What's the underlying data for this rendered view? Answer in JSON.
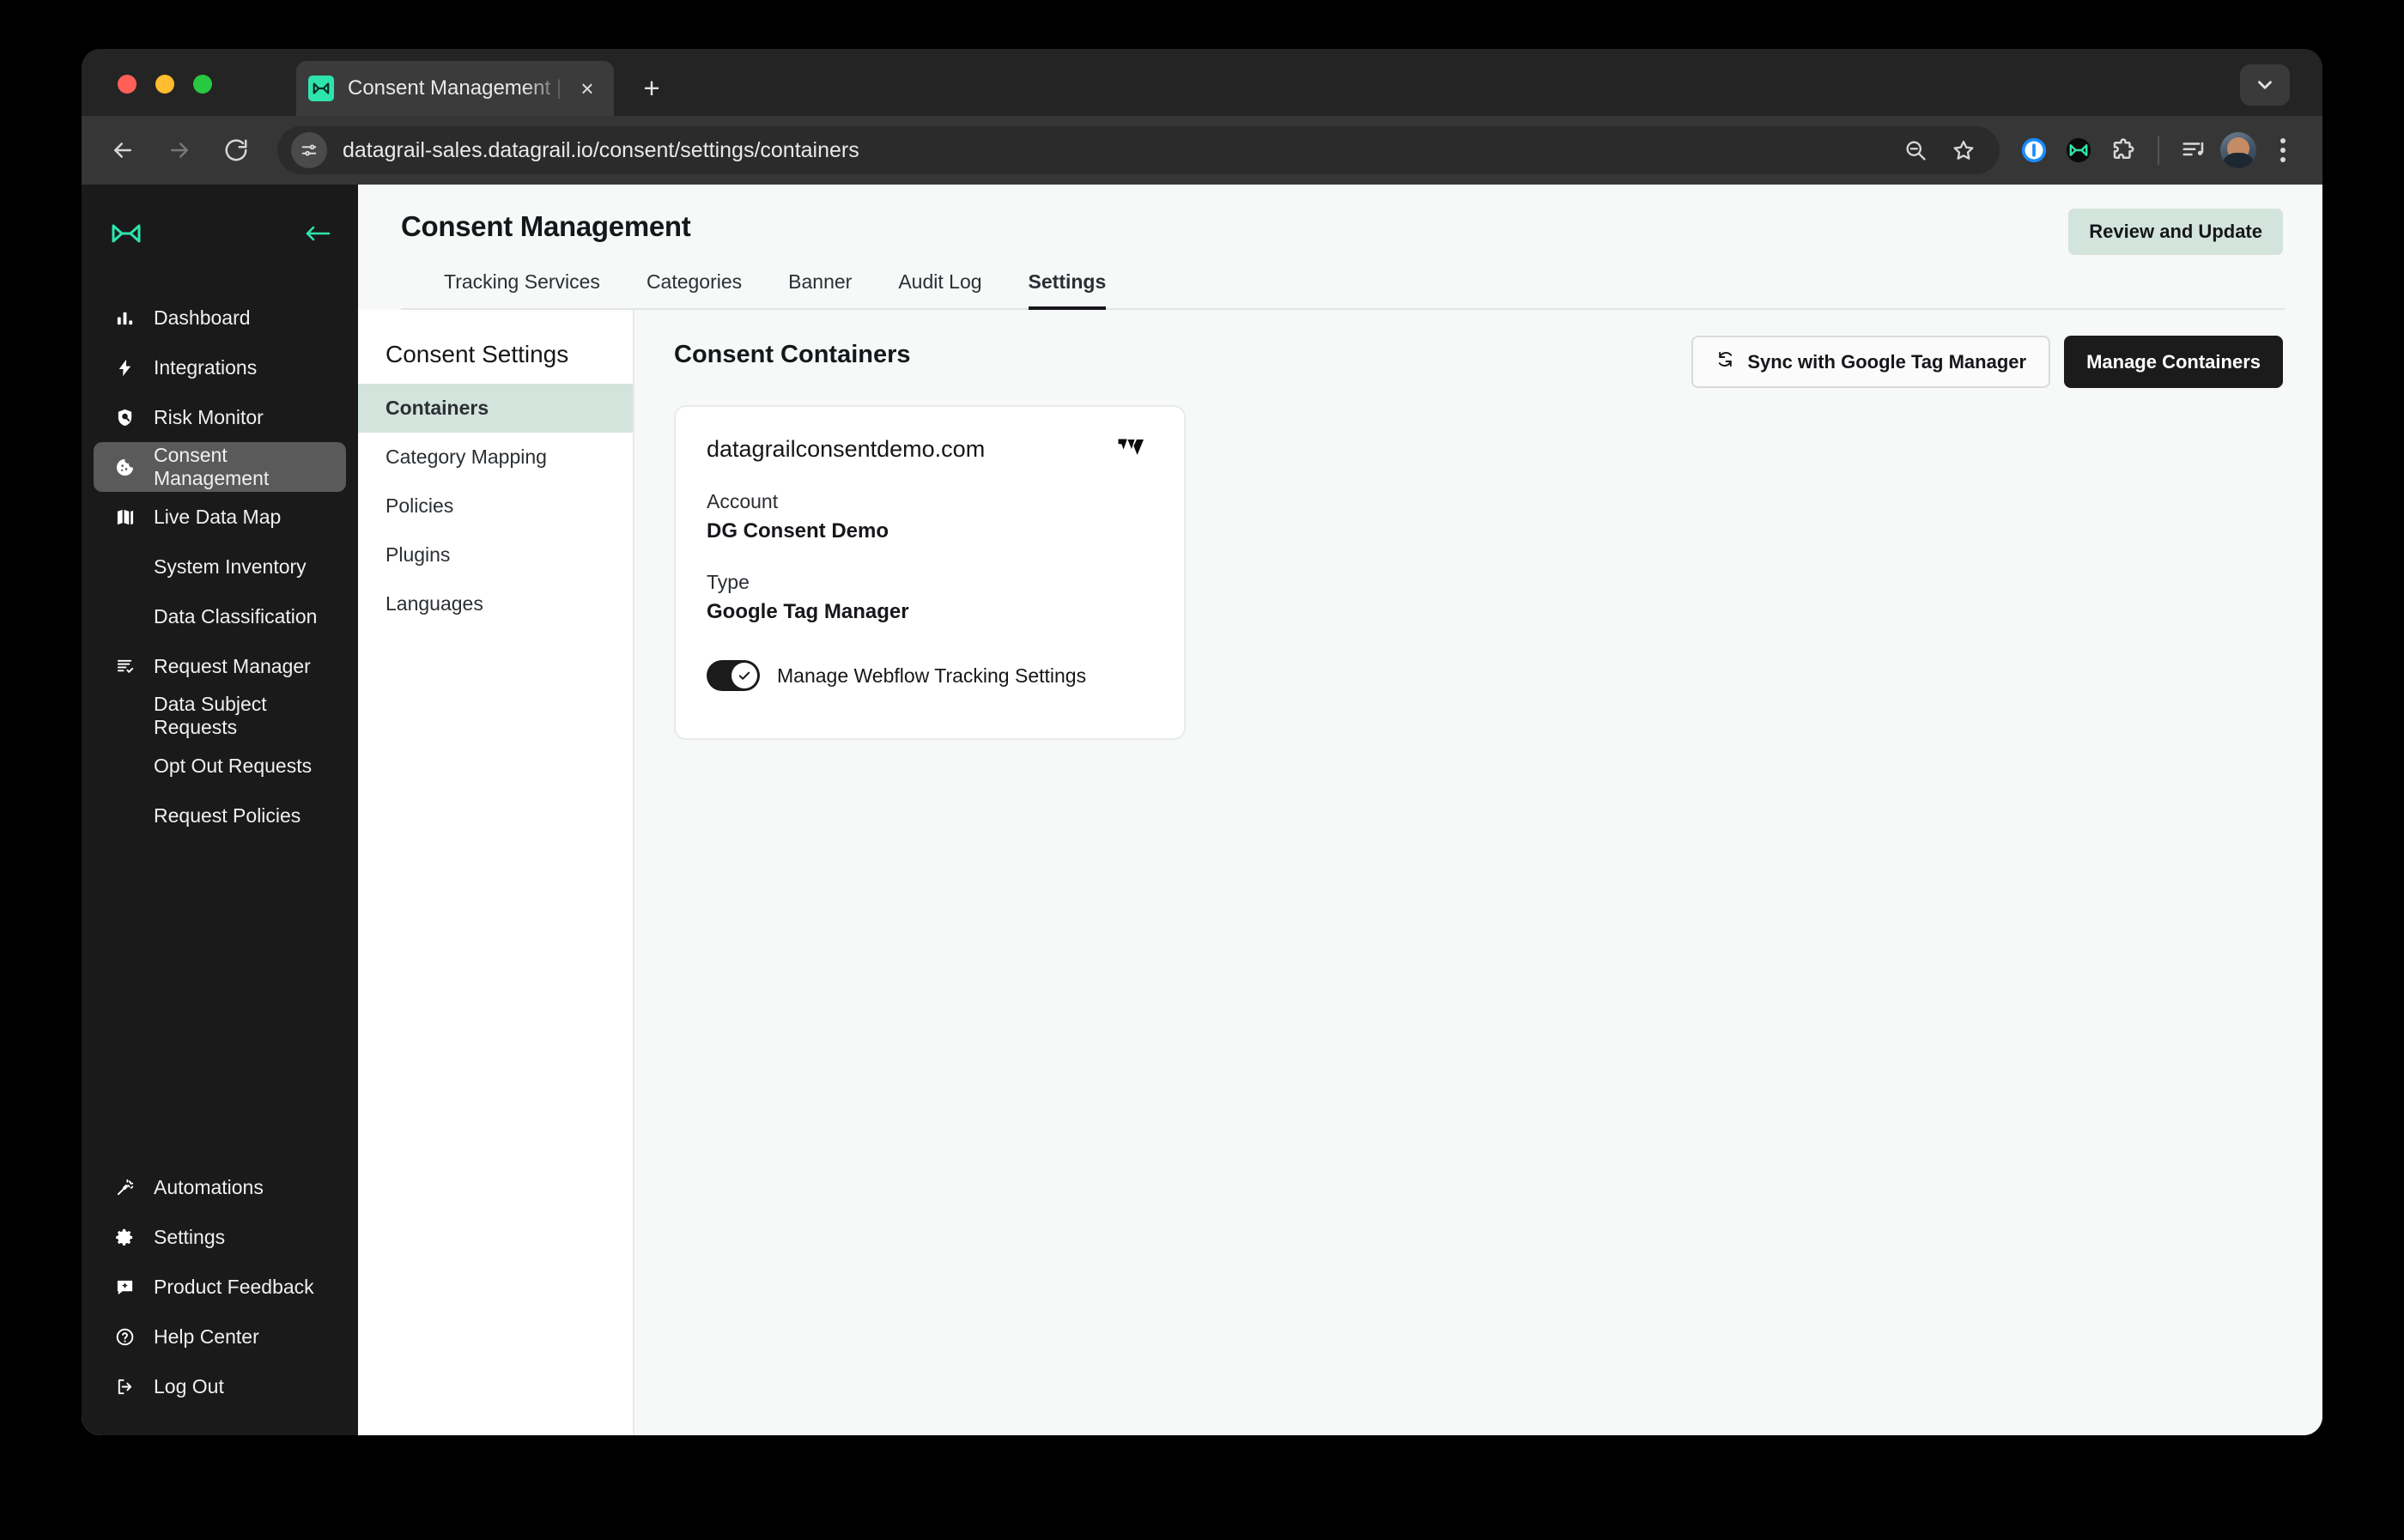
{
  "browser": {
    "tab": {
      "title": "Consent Management | DataG",
      "favicon": "datagrail-logo-icon",
      "close": "×"
    },
    "new_tab": "+",
    "window_chevron": "chevron-down-icon",
    "url": "datagrail-sales.datagrail.io/consent/settings/containers",
    "nav": {
      "back": "back-icon",
      "forward": "forward-icon",
      "reload": "reload-icon"
    },
    "omnibox_icon": "site-settings-icon",
    "toolbar_icons": [
      "zoom-out-icon",
      "bookmark-star-icon",
      "onepassword-extension-icon",
      "datagrail-extension-icon",
      "extensions-puzzle-icon",
      "media-playlist-icon",
      "profile-avatar",
      "chrome-menu-icon"
    ]
  },
  "sidebar": {
    "logo": "datagrail-logo-icon",
    "collapse": "collapse-arrow-icon",
    "accent": "#2de5ac",
    "items": [
      {
        "label": "Dashboard",
        "icon": "bar-chart-icon",
        "sub": false,
        "active": false
      },
      {
        "label": "Integrations",
        "icon": "lightning-bolt-icon",
        "sub": false,
        "active": false
      },
      {
        "label": "Risk Monitor",
        "icon": "shield-search-icon",
        "sub": false,
        "active": false
      },
      {
        "label": "Consent Management",
        "icon": "cookie-icon",
        "sub": false,
        "active": true
      },
      {
        "label": "Live Data Map",
        "icon": "map-icon",
        "sub": false,
        "active": false
      },
      {
        "label": "System Inventory",
        "icon": "",
        "sub": true,
        "active": false
      },
      {
        "label": "Data Classification",
        "icon": "",
        "sub": true,
        "active": false
      },
      {
        "label": "Request Manager",
        "icon": "list-check-icon",
        "sub": false,
        "active": false
      },
      {
        "label": "Data Subject Requests",
        "icon": "",
        "sub": true,
        "active": false
      },
      {
        "label": "Opt Out Requests",
        "icon": "",
        "sub": true,
        "active": false
      },
      {
        "label": "Request Policies",
        "icon": "",
        "sub": true,
        "active": false
      }
    ],
    "bottom_items": [
      {
        "label": "Automations",
        "icon": "magic-wand-icon"
      },
      {
        "label": "Settings",
        "icon": "gear-icon"
      },
      {
        "label": "Product Feedback",
        "icon": "feedback-icon"
      },
      {
        "label": "Help Center",
        "icon": "question-circle-icon"
      },
      {
        "label": "Log Out",
        "icon": "logout-icon"
      }
    ]
  },
  "header": {
    "title": "Consent Management",
    "review_button": "Review and Update",
    "review_button_color": "#d3e4dc"
  },
  "tabs": [
    {
      "label": "Tracking Services",
      "active": false
    },
    {
      "label": "Categories",
      "active": false
    },
    {
      "label": "Banner",
      "active": false
    },
    {
      "label": "Audit Log",
      "active": false
    },
    {
      "label": "Settings",
      "active": true
    }
  ],
  "settings_nav": {
    "title": "Consent Settings",
    "items": [
      {
        "label": "Containers",
        "active": true
      },
      {
        "label": "Category Mapping",
        "active": false
      },
      {
        "label": "Policies",
        "active": false
      },
      {
        "label": "Plugins",
        "active": false
      },
      {
        "label": "Languages",
        "active": false
      }
    ],
    "active_color": "#d3e4dc"
  },
  "panel": {
    "title": "Consent Containers",
    "sync_button": "Sync with Google Tag Manager",
    "sync_icon": "sync-refresh-icon",
    "manage_button": "Manage Containers"
  },
  "container_card": {
    "domain": "datagrailconsentdemo.com",
    "logo": "webflow-logo-icon",
    "account_label": "Account",
    "account_value": "DG Consent Demo",
    "type_label": "Type",
    "type_value": "Google Tag Manager",
    "toggle_label": "Manage Webflow Tracking Settings",
    "toggle_on": true
  }
}
